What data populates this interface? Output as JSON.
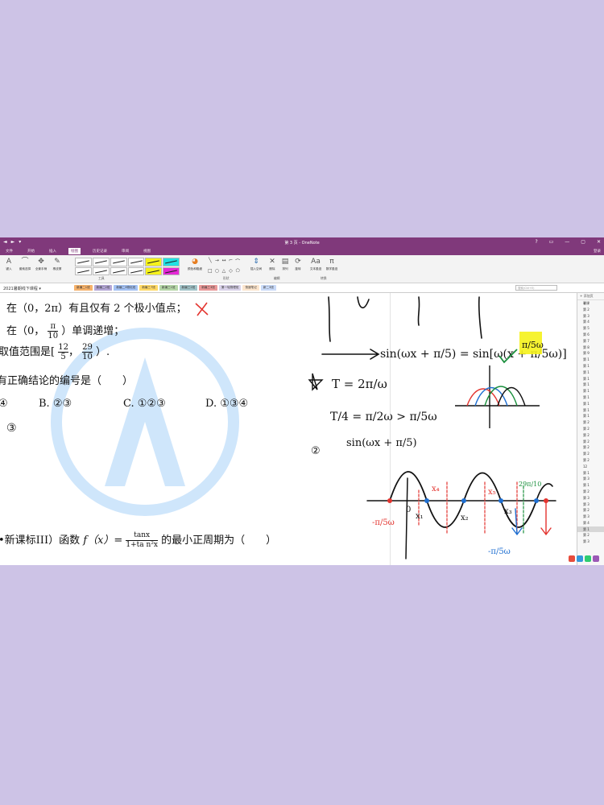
{
  "window": {
    "title": "第 3 页 - OneNote",
    "quick_access": [
      "◄",
      "►",
      "▾"
    ],
    "window_controls": [
      "?",
      "▭",
      "—",
      "▢",
      "✕"
    ],
    "login": "登录"
  },
  "menu": {
    "tabs": [
      "文件",
      "开始",
      "插入",
      "绘图",
      "历史记录",
      "审阅",
      "视图"
    ],
    "active": "绘图"
  },
  "ribbon": {
    "tools": [
      {
        "label": "键入",
        "icon": "A"
      },
      {
        "label": "套索选择",
        "icon": "⌒"
      },
      {
        "label": "全景手柄",
        "icon": "✥"
      },
      {
        "label": "橡皮擦",
        "icon": "✎"
      }
    ],
    "color_tool": {
      "label": "颜色和粗细",
      "icon": "◕"
    },
    "edit_tools": [
      {
        "label": "插入空间",
        "icon": "⇕"
      },
      {
        "label": "删除",
        "icon": "✕"
      },
      {
        "label": "排列",
        "icon": "▤"
      },
      {
        "label": "旋转",
        "icon": "⟳"
      }
    ],
    "convert_tools": [
      {
        "label": "文本墨迹",
        "icon": "Aa"
      },
      {
        "label": "数学墨迹",
        "icon": "π"
      }
    ],
    "group_labels": {
      "tools": "工具",
      "shapes": "形状",
      "edit": "编辑",
      "convert": "转换"
    },
    "shape_glyphs": [
      "╲",
      "→",
      "↔",
      "⌐",
      "⌒",
      "□",
      "○",
      "△",
      "◇",
      "⬠"
    ]
  },
  "notebook": {
    "name": "2021暑期线下课程",
    "sections": [
      {
        "label": "新编二1班",
        "color": "#f6b26b"
      },
      {
        "label": "新编二2班",
        "color": "#b4a7d6"
      },
      {
        "label": "新编二3物化班",
        "color": "#a4c2f4"
      },
      {
        "label": "新编三7班",
        "color": "#ffd966"
      },
      {
        "label": "新编三1班",
        "color": "#b6d7a8"
      },
      {
        "label": "新编三2班",
        "color": "#a2c4c9"
      },
      {
        "label": "新编三3班",
        "color": "#ea9999"
      },
      {
        "label": "第一轮物理班",
        "color": "#d9d2e9"
      },
      {
        "label": "快速笔记",
        "color": "#fce5cd"
      },
      {
        "label": "新二3班",
        "color": "#c9daf8"
      }
    ],
    "search_placeholder": "搜索(Ctrl+E)"
  },
  "content": {
    "line1": "在（0，2π）有且仅有 2 个极小值点；",
    "line2a": "在（0，",
    "line2_frac_num": "π",
    "line2_frac_den": "10",
    "line2b": "）单调递增；",
    "line3a": "取值范围是[",
    "line3_f1_num": "12",
    "line3_f1_den": "5",
    "line3_sep": "，",
    "line3_f2_num": "29",
    "line3_f2_den": "10",
    "line3b": "）.",
    "line4": "有正确结论的编号是（　　）",
    "options": [
      {
        "label": "④",
        "text": ""
      },
      {
        "label": "B.",
        "text": "②③"
      },
      {
        "label": "C.",
        "text": "①②③"
      },
      {
        "label": "D.",
        "text": "①③④"
      }
    ],
    "question_prefix": "•新课标III）函数",
    "question_func": "f（x）=",
    "question_frac_num": "tanx",
    "question_frac_den": "1+ta n²x",
    "question_suffix": "的最小正周期为（　　）",
    "handwritten_note": "③",
    "math_line1": "sin(ωx + π/5) = sin[ω(x + π/5ω)]",
    "math_T": "T = 2π/ω",
    "math_quarter": "T/4 = π/2ω > π/5ω",
    "math_circle2": "②",
    "math_sin2": "sin(ωx + π/5)",
    "graph_labels": [
      "-π/5ω",
      "0",
      "x₁",
      "x₂",
      "x₃",
      "x₄",
      "x₅",
      "29π/10",
      "-π/5ω"
    ]
  },
  "pagelist": {
    "add_label": "+ 添加页",
    "pages": [
      "暑课",
      "第 2",
      "第 3",
      "第 4",
      "第 5",
      "第 6",
      "第 7",
      "第 8",
      "第 9",
      "第 1",
      "第 1",
      "第 1",
      "第 1",
      "第 1",
      "第 1",
      "第 1",
      "第 1",
      "第 1",
      "第 1",
      "第 2",
      "第 2",
      "第 2",
      "第 2",
      "第 2",
      "第 2",
      "第 2",
      "12",
      "第 1",
      "第 3",
      "第 1",
      "第 2",
      "第 3",
      "第 3",
      "第 2",
      "第 3",
      "第 4",
      "第 1",
      "第 2",
      "第 3"
    ],
    "active_index": 36
  },
  "colors": {
    "brand": "#80397b",
    "ink_red": "#e3342f",
    "ink_blue": "#1f6fd1",
    "highlight": "#f5f21b",
    "watermark": "#cfe6fb"
  }
}
